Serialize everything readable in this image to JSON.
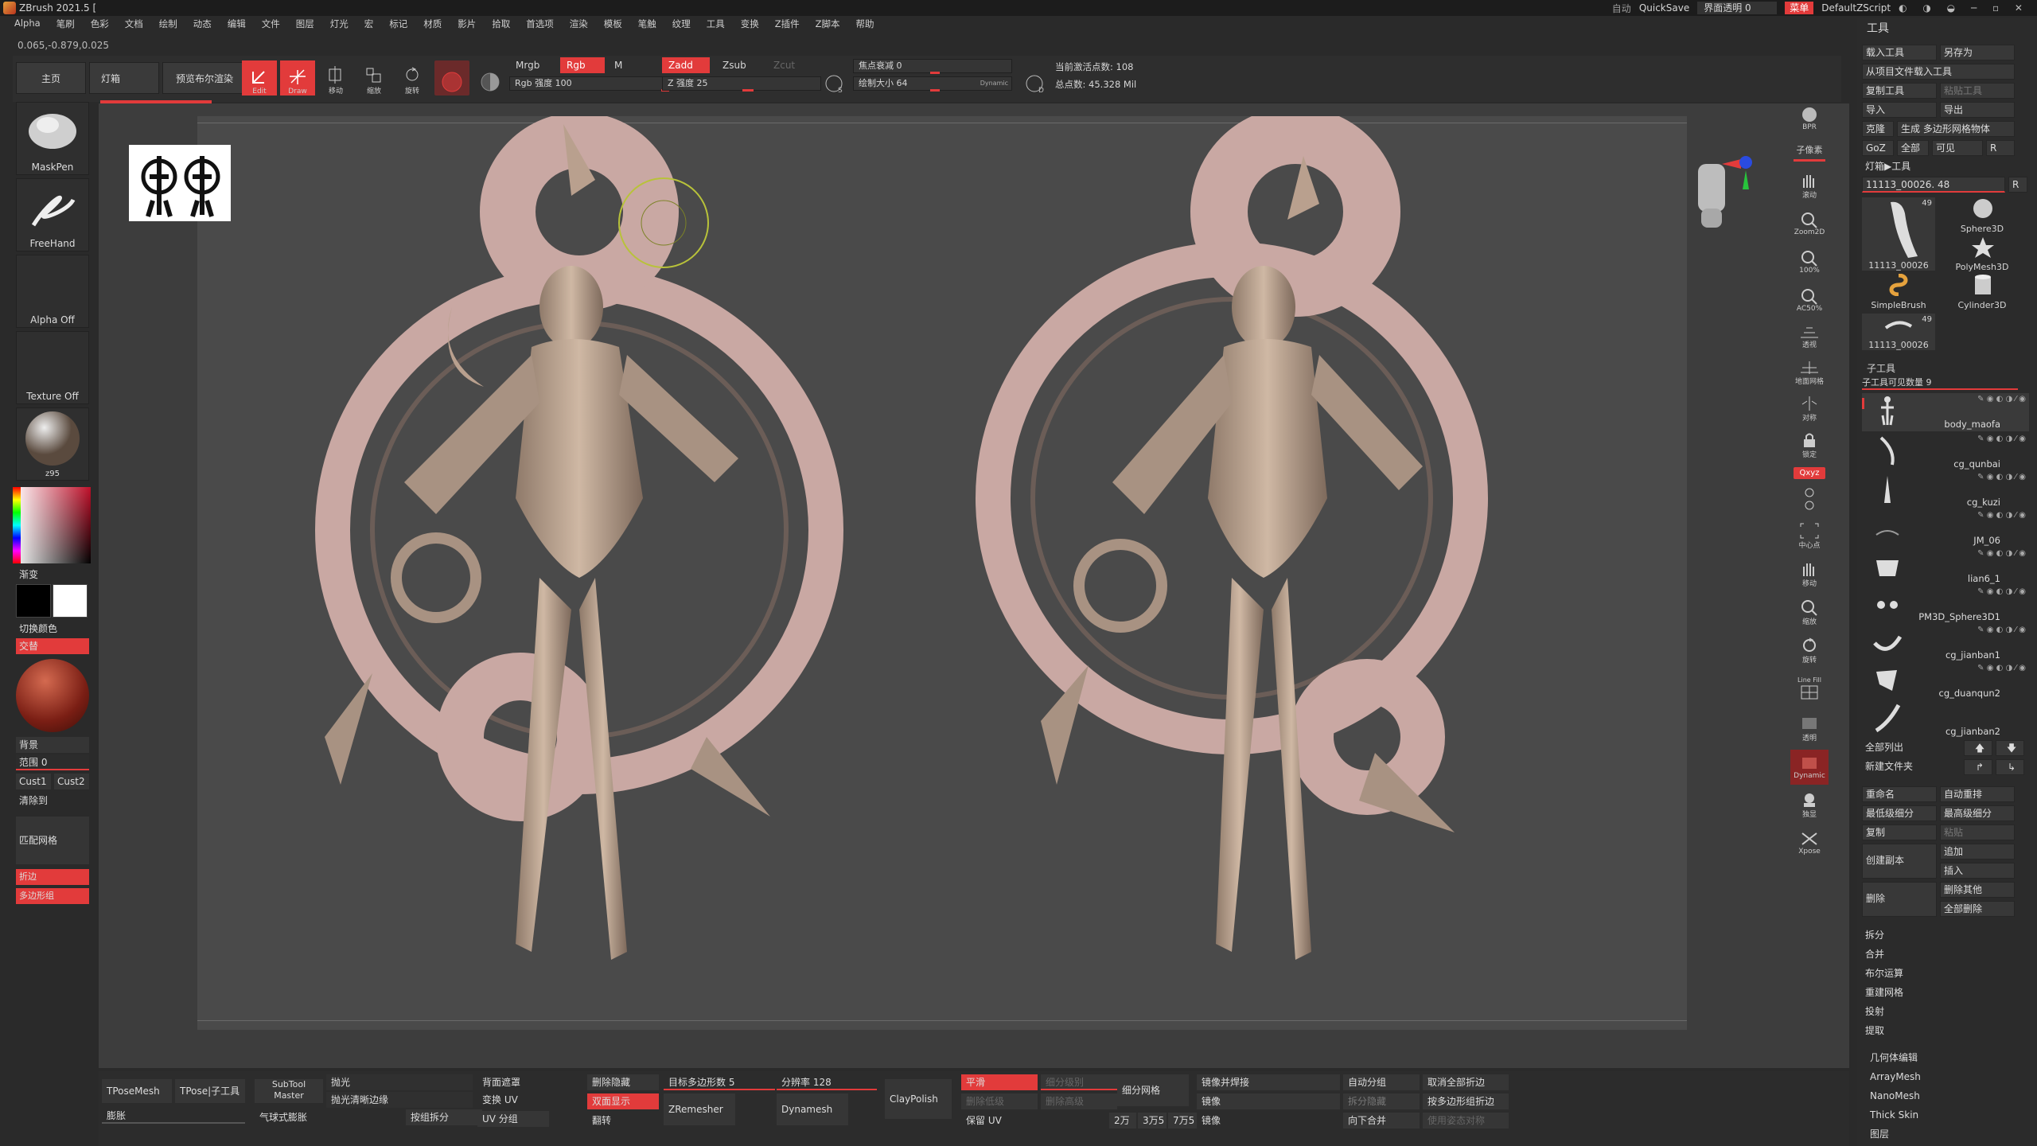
{
  "title_bar": {
    "app_title": "ZBrush 2021.5 [",
    "auto": "自动",
    "quicksave": "QuickSave",
    "transparency": "界面透明 0",
    "menu": "菜单",
    "script": "DefaultZScript"
  },
  "menu_bar": [
    "Alpha",
    "笔刷",
    "色彩",
    "文档",
    "绘制",
    "动态",
    "编辑",
    "文件",
    "图层",
    "灯光",
    "宏",
    "标记",
    "材质",
    "影片",
    "拾取",
    "首选项",
    "渲染",
    "模板",
    "笔触",
    "纹理",
    "工具",
    "变换",
    "Z插件",
    "Z脚本",
    "帮助"
  ],
  "coords": "0.065,-0.879,0.025",
  "toolbar": {
    "home": "主页",
    "lightbox": "灯箱",
    "bpr": "预览布尔渲染",
    "edit": "Edit",
    "draw": "Draw",
    "move": "移动",
    "scale": "缩放",
    "rotate": "旋转",
    "mrgb": "Mrgb",
    "rgb": "Rgb",
    "m": "M",
    "rgb_intensity": "Rgb 强度 100",
    "zadd": "Zadd",
    "zsub": "Zsub",
    "zcut": "Zcut",
    "z_intensity": "Z 强度 25",
    "focal": "焦点衰减 0",
    "draw_size": "绘制大小 64",
    "dynamic": "Dynamic",
    "active_points": "当前激活点数: 108",
    "total_points": "总点数: 45.328 Mil"
  },
  "left_panel": {
    "brush": "MaskPen",
    "stroke": "FreeHand",
    "alpha": "Alpha Off",
    "texture": "Texture Off",
    "material": "z95",
    "gradient": "渐变",
    "switch_color": "切换颜色",
    "alternate": "交替",
    "background": "背景",
    "range": "范围 0",
    "cust1": "Cust1",
    "cust2": "Cust2",
    "clear": "清除到",
    "match_mesh": "匹配网格",
    "fold": "折边",
    "polygroup": "多边形组"
  },
  "nav": [
    {
      "name": "bpr",
      "label": "BPR"
    },
    {
      "name": "subpixel",
      "label": "子像素"
    },
    {
      "name": "scroll",
      "label": "滚动"
    },
    {
      "name": "zoom2d",
      "label": "Zoom2D"
    },
    {
      "name": "zoom100",
      "label": "100%"
    },
    {
      "name": "ac50",
      "label": "AC50%"
    },
    {
      "name": "dynamic-persp",
      "label": "透视"
    },
    {
      "name": "floor",
      "label": "地面网格"
    },
    {
      "name": "local",
      "label": "对称"
    },
    {
      "name": "lock",
      "label": "锁定"
    },
    {
      "name": "qxyz",
      "label": "Qxyz"
    },
    {
      "name": "frame",
      "label": "中心点"
    },
    {
      "name": "move",
      "label": "移动"
    },
    {
      "name": "zoom3d",
      "label": "缩放"
    },
    {
      "name": "rotate",
      "label": "旋转"
    },
    {
      "name": "linefill",
      "label": "Line Fill"
    },
    {
      "name": "transp",
      "label": "透明"
    },
    {
      "name": "ghost",
      "label": "Dynamic"
    },
    {
      "name": "solo",
      "label": "独显"
    },
    {
      "name": "xpose",
      "label": "Xpose"
    }
  ],
  "tool_panel": {
    "title": "工具",
    "load_tool": "载入工具",
    "save_as": "另存为",
    "load_from_project": "从项目文件载入工具",
    "copy_tool": "复制工具",
    "paste_tool": "粘贴工具",
    "import": "导入",
    "export": "导出",
    "clone": "克隆",
    "make_polymesh": "生成 多边形网格物体",
    "goz": "GoZ",
    "all": "全部",
    "visible": "可见",
    "r": "R",
    "lightbox_tools": "灯箱▶工具",
    "current_tool": "11113_00026. 48",
    "tools": [
      {
        "name": "11113_00026",
        "count": "49"
      },
      {
        "name": "Sphere3D",
        "count": ""
      },
      {
        "name": "SimpleBrush",
        "count": ""
      },
      {
        "name": "PolyMesh3D",
        "count": ""
      },
      {
        "name": "Cylinder3D",
        "count": ""
      },
      {
        "name": "11113_00026",
        "count": "49"
      }
    ],
    "subtool_header": "子工具",
    "visible_count": "子工具可见数量 9",
    "subtools": [
      "body_maofa",
      "cg_qunbai",
      "cg_kuzi",
      "JM_06",
      "lian6_1",
      "PM3D_Sphere3D1",
      "cg_jianban1",
      "cg_duanqun2",
      "cg_jianban2"
    ],
    "list_all": "全部列出",
    "new_folder": "新建文件夹",
    "rename": "重命名",
    "auto_reorder": "自动重排",
    "lowest_sub": "最低级细分",
    "highest_sub": "最高级细分",
    "duplicate": "复制",
    "paste": "粘贴",
    "create_copy": "创建副本",
    "append": "追加",
    "insert": "插入",
    "delete": "删除",
    "delete_other": "删除其他",
    "delete_all": "全部删除",
    "split": "拆分",
    "merge": "合并",
    "boolean": "布尔运算",
    "remesh": "重建网格",
    "project": "投射",
    "extract": "提取",
    "geometry": "几何体编辑",
    "arraymesh": "ArrayMesh",
    "nanomesh": "NanoMesh",
    "thickskin": "Thick Skin",
    "layers": "图层"
  },
  "bottom_shelf": {
    "tposemesh": "TPoseMesh",
    "tpose_subtool": "TPose|子工具",
    "subtool_master": "SubTool Master",
    "polish": "抛光",
    "polish_crisp": "抛光清晰边缘",
    "inflate": "膨胀",
    "spray_inflate": "气球式膨胀",
    "split_by_group": "按组拆分",
    "backface_mask": "背面遮罩",
    "transform_uv": "变换 UV",
    "uv_groups": "UV 分组",
    "del_hidden": "删除隐藏",
    "double_sided": "双面显示",
    "flip": "翻转",
    "target_polys": "目标多边形数 5",
    "zremesher": "ZRemesher",
    "resolution": "分辨率 128",
    "dynamesh": "Dynamesh",
    "claypolish": "ClayPolish",
    "smooth": "平滑",
    "subdiv_level": "细分级别",
    "del_lower": "删除低级",
    "del_higher": "删除高级",
    "keep_uv": "保留 UV",
    "divide": "细分网格",
    "t20k": "2万",
    "t35k": "3万5",
    "t75k": "7万5",
    "mirror_weld": "镜像并焊接",
    "mirror": "镜像",
    "mirror2": "镜像",
    "auto_group": "自动分组",
    "split_hidden": "拆分隐藏",
    "merge_down": "向下合并",
    "uncrease_all": "取消全部折边",
    "crease_pg": "按多边形组折边",
    "use_pose_sym": "使用姿态对称"
  },
  "colors": {
    "accent": "#e23b3b",
    "panel": "#2b2b2b",
    "canvas": "#4a4a4a",
    "model": "#c8b09c",
    "ring": "#c9a8a3"
  }
}
